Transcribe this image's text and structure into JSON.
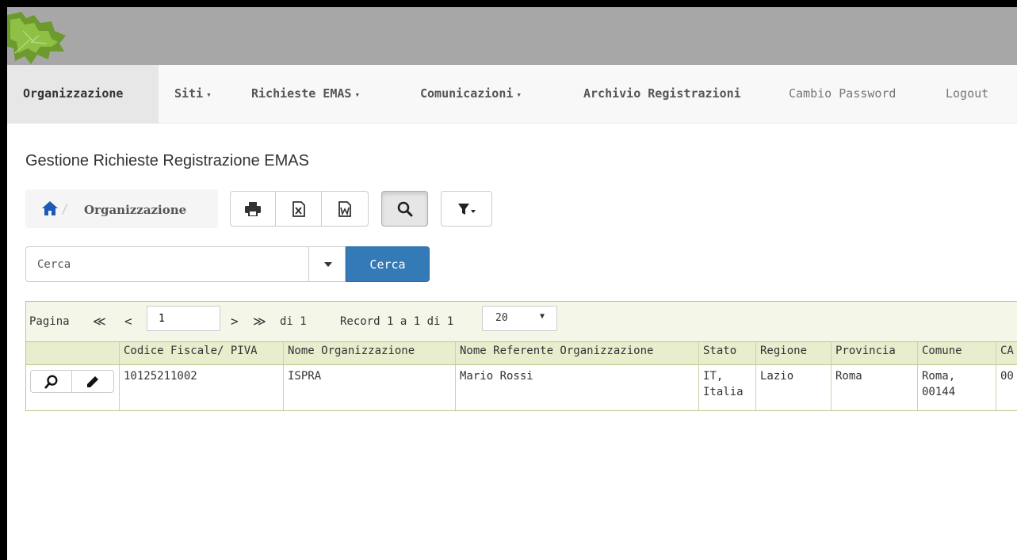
{
  "nav": {
    "items": [
      {
        "label": "Organizzazione",
        "dropdown": false,
        "active": true
      },
      {
        "label": "Siti",
        "dropdown": true
      },
      {
        "label": "Richieste EMAS",
        "dropdown": true
      },
      {
        "label": "Comunicazioni",
        "dropdown": true
      },
      {
        "label": "Archivio Registrazioni",
        "dropdown": false
      }
    ],
    "change_password": "Cambio Password",
    "logout": "Logout",
    "caret": "▾"
  },
  "page": {
    "title": "Gestione Richieste Registrazione EMAS"
  },
  "breadcrumb": {
    "separator": "/",
    "current": "Organizzazione"
  },
  "search": {
    "placeholder": "Cerca",
    "button_label": "Cerca"
  },
  "pager": {
    "label_page": "Pagina",
    "first": "≪",
    "prev": "<",
    "current_page": "1",
    "next": ">",
    "last": "≫",
    "of_total": "di 1",
    "record_info": "Record 1 a 1 di 1",
    "page_size": "20"
  },
  "table": {
    "columns": [
      "Codice Fiscale/ PIVA",
      "Nome Organizzazione",
      "Nome Referente Organizzazione",
      "Stato",
      "Regione",
      "Provincia",
      "Comune",
      "CA"
    ],
    "rows": [
      {
        "codice_fiscale": "10125211002",
        "nome_organizzazione": "ISPRA",
        "nome_referente": "Mario Rossi",
        "stato_line1": "IT,",
        "stato_line2": "Italia",
        "regione": "Lazio",
        "provincia": "Roma",
        "comune_line1": "Roma,",
        "comune_line2": "00144",
        "cap": "00"
      }
    ]
  },
  "colors": {
    "banner": "#a7a7a7",
    "navbar": "#f8f8f8",
    "primary": "#337ab7",
    "grid_border": "#b8c98f",
    "grid_header": "#e8edce"
  }
}
